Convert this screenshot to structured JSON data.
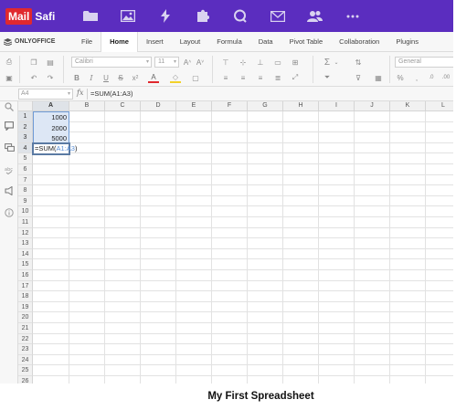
{
  "app": {
    "logo_mail": "Mail",
    "logo_safi": "Safi",
    "nav_icons": [
      "folder-icon",
      "image-icon",
      "lightning-icon",
      "puzzle-icon",
      "chat-icon",
      "mail-icon",
      "users-icon",
      "more-icon"
    ]
  },
  "menubar": {
    "brand": "ONLYOFFICE",
    "items": [
      "File",
      "Home",
      "Insert",
      "Layout",
      "Formula",
      "Data",
      "Pivot Table",
      "Collaboration",
      "Plugins"
    ],
    "active": "Home"
  },
  "toolbar": {
    "font_name": "Calibri",
    "font_size": "11",
    "number_format": "General",
    "buttons": [
      "print-icon",
      "save-icon",
      "copy-icon",
      "paste-icon",
      "undo-icon",
      "redo-icon",
      "bold-icon",
      "italic-icon",
      "underline-icon",
      "strikethrough-icon",
      "subscript-icon",
      "font-color-icon",
      "fill-color-icon",
      "borders-icon",
      "increase-font-icon",
      "decrease-font-icon",
      "align-top-icon",
      "align-middle-icon",
      "align-bottom-icon",
      "wrap-text-icon",
      "merge-icon",
      "align-left-icon",
      "align-center-icon",
      "align-right-icon",
      "justify-icon",
      "sum-icon",
      "filter-icon",
      "sort-icon",
      "clear-filter-icon",
      "percent-icon",
      "comma-icon"
    ]
  },
  "formula_bar": {
    "name_box": "A4",
    "fx_label": "fx",
    "formula": "=SUM(A1:A3)"
  },
  "grid": {
    "columns": [
      "A",
      "B",
      "C",
      "D",
      "E",
      "F",
      "G",
      "H",
      "I",
      "J",
      "K",
      "L"
    ],
    "rows": [
      "1",
      "2",
      "3",
      "4",
      "5",
      "6",
      "7",
      "8",
      "9",
      "10",
      "11",
      "12",
      "13",
      "14",
      "15",
      "16",
      "17",
      "18",
      "19",
      "20",
      "21",
      "22",
      "23",
      "24",
      "25",
      "26"
    ],
    "cells": {
      "A1": "1000",
      "A2": "2000",
      "A3": "5000",
      "A4_prefix": "=SUM(",
      "A4_ref": "A1:A3",
      "A4_suffix": ")"
    }
  },
  "sidebar": {
    "icons": [
      "search-icon",
      "comment-icon",
      "chat-icon",
      "spellcheck-icon",
      "feedback-icon",
      "info-icon"
    ]
  },
  "caption": "My First Spreadsheet",
  "colors": {
    "appbar": "#5b2dbf",
    "logo_red": "#e0282e",
    "range_fill": "#dde7f5",
    "range_ref": "#5a8fd6"
  }
}
